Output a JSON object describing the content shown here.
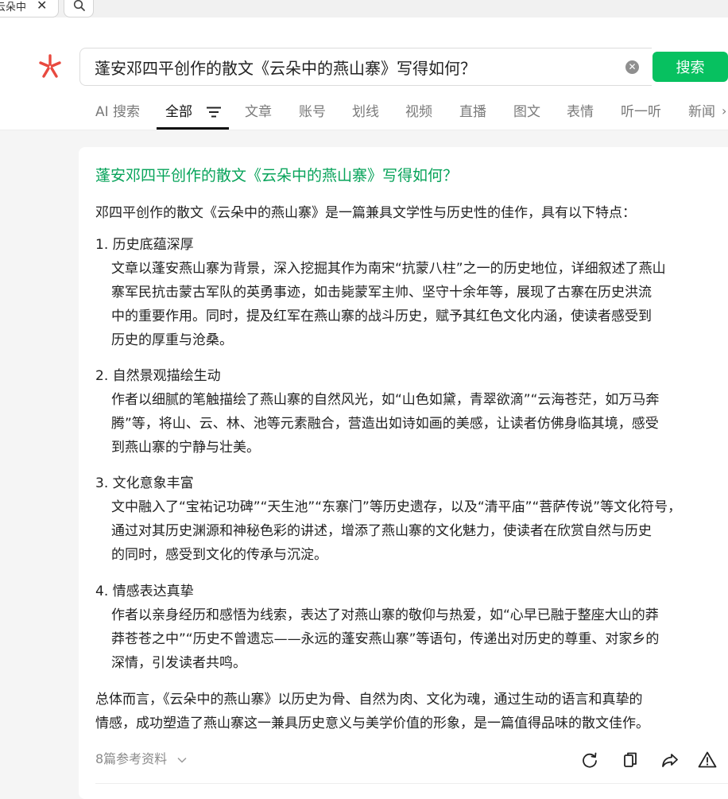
{
  "browser": {
    "tab_title": "云朵中",
    "tab_close": "✕"
  },
  "search": {
    "query": "蓬安邓四平创作的散文《云朵中的燕山寨》写得如何？",
    "clear": "✕",
    "button_label": "搜索"
  },
  "nav": {
    "items": [
      "AI 搜索",
      "全部",
      "文章",
      "账号",
      "划线",
      "视频",
      "直播",
      "图文",
      "表情",
      "听一听",
      "新闻"
    ],
    "active": "全部",
    "more": "›"
  },
  "answer": {
    "question": "蓬安邓四平创作的散文《云朵中的燕山寨》写得如何？",
    "intro": "邓四平创作的散文《云朵中的燕山寨》是一篇兼具文学性与历史性的佳作，具有以下特点：",
    "points": [
      {
        "title": "1. 历史底蕴深厚",
        "lines": [
          "文章以蓬安燕山寨为背景，深入挖掘其作为南宋“抗蒙八柱”之一的历史地位，详细叙述了燕山",
          "寨军民抗击蒙古军队的英勇事迹，如击毙蒙军主帅、坚守十余年等，展现了古寨在历史洪流",
          "中的重要作用。同时，提及红军在燕山寨的战斗历史，赋予其红色文化内涵，使读者感受到",
          "历史的厚重与沧桑。"
        ]
      },
      {
        "title": "2. 自然景观描绘生动",
        "lines": [
          "作者以细腻的笔触描绘了燕山寨的自然风光，如“山色如黛，青翠欲滴”“云海苍茫，如万马奔",
          "腾”等，将山、云、林、池等元素融合，营造出如诗如画的美感，让读者仿佛身临其境，感受",
          "到燕山寨的宁静与壮美。"
        ]
      },
      {
        "title": "3. 文化意象丰富",
        "lines": [
          "文中融入了“宝祐记功碑”“天生池”“东寨门”等历史遗存，以及“清平庙”“菩萨传说”等文化符号，",
          "通过对其历史渊源和神秘色彩的讲述，增添了燕山寨的文化魅力，使读者在欣赏自然与历史",
          "的同时，感受到文化的传承与沉淀。"
        ]
      },
      {
        "title": "4. 情感表达真挚",
        "lines": [
          "作者以亲身经历和感悟为线索，表达了对燕山寨的敬仰与热爱，如“心早已融于整座大山的莽",
          "莽苍苍之中”“历史不曾遗忘——永远的蓬安燕山寨”等语句，传递出对历史的尊重、对家乡的",
          "深情，引发读者共鸣。"
        ]
      }
    ],
    "summary_lines": [
      "总体而言，《云朵中的燕山寨》以历史为骨、自然为肉、文化为魂，通过生动的语言和真挚的",
      "情感，成功塑造了燕山寨这一兼具历史意义与美学价值的形象，是一篇值得品味的散文佳作。"
    ],
    "references_label": "8篇参考资料"
  },
  "icons": {
    "logo": "weixin-search-logo",
    "search": "search-icon",
    "filter": "filter-icon",
    "refresh": "refresh-icon",
    "copy": "copy-icon",
    "share": "share-icon",
    "report": "warning-icon"
  },
  "colors": {
    "accent": "#07c160",
    "question": "#07a35a",
    "logo": "#e8493f"
  }
}
